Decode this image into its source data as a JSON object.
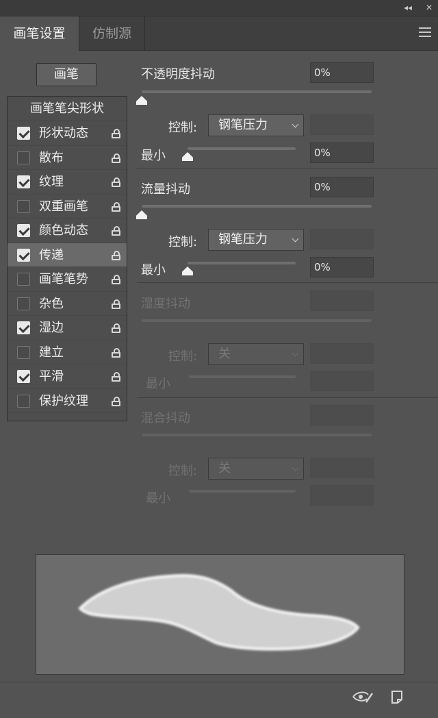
{
  "window": {
    "collapse_label": "◂◂",
    "close_label": "✕"
  },
  "tabs": [
    {
      "label": "画笔设置",
      "active": true
    },
    {
      "label": "仿制源",
      "active": false
    }
  ],
  "menu_icon": "hamburger-menu-icon",
  "brush_button_label": "画笔",
  "left_panel": {
    "header": "画笔笔尖形状",
    "items": [
      {
        "label": "形状动态",
        "checked": true,
        "selected": false
      },
      {
        "label": "散布",
        "checked": false,
        "selected": false
      },
      {
        "label": "纹理",
        "checked": true,
        "selected": false
      },
      {
        "label": "双重画笔",
        "checked": false,
        "selected": false
      },
      {
        "label": "颜色动态",
        "checked": true,
        "selected": false
      },
      {
        "label": "传递",
        "checked": true,
        "selected": true
      },
      {
        "label": "画笔笔势",
        "checked": false,
        "selected": false
      },
      {
        "label": "杂色",
        "checked": false,
        "selected": false
      },
      {
        "label": "湿边",
        "checked": true,
        "selected": false
      },
      {
        "label": "建立",
        "checked": false,
        "selected": false
      },
      {
        "label": "平滑",
        "checked": true,
        "selected": false
      },
      {
        "label": "保护纹理",
        "checked": false,
        "selected": false
      }
    ],
    "lock_icon": "lock-icon"
  },
  "sections": {
    "opacity": {
      "title": "不透明度抖动",
      "value": "0%",
      "jitter_level": 0,
      "control_label": "控制:",
      "control_value": "钢笔压力",
      "min_label": "最小",
      "min_value": "0%",
      "min_level": 0
    },
    "flow": {
      "title": "流量抖动",
      "value": "0%",
      "jitter_level": 0,
      "control_label": "控制:",
      "control_value": "钢笔压力",
      "min_label": "最小",
      "min_value": "0%",
      "min_level": 0
    },
    "wetness": {
      "title": "湿度抖动",
      "value": "",
      "control_label": "控制:",
      "control_value": "关",
      "min_label": "最小",
      "min_value": ""
    },
    "mix": {
      "title": "混合抖动",
      "value": "",
      "control_label": "控制:",
      "control_value": "关",
      "min_label": "最小",
      "min_value": ""
    }
  },
  "bottom": {
    "left_icon": "eye-brush-icon",
    "right_icon": "new-brush-icon"
  },
  "colors": {
    "panel_bg": "#535353",
    "selected_row": "#6a6a6a",
    "text": "#e6e6e6",
    "disabled_text": "#727272"
  }
}
